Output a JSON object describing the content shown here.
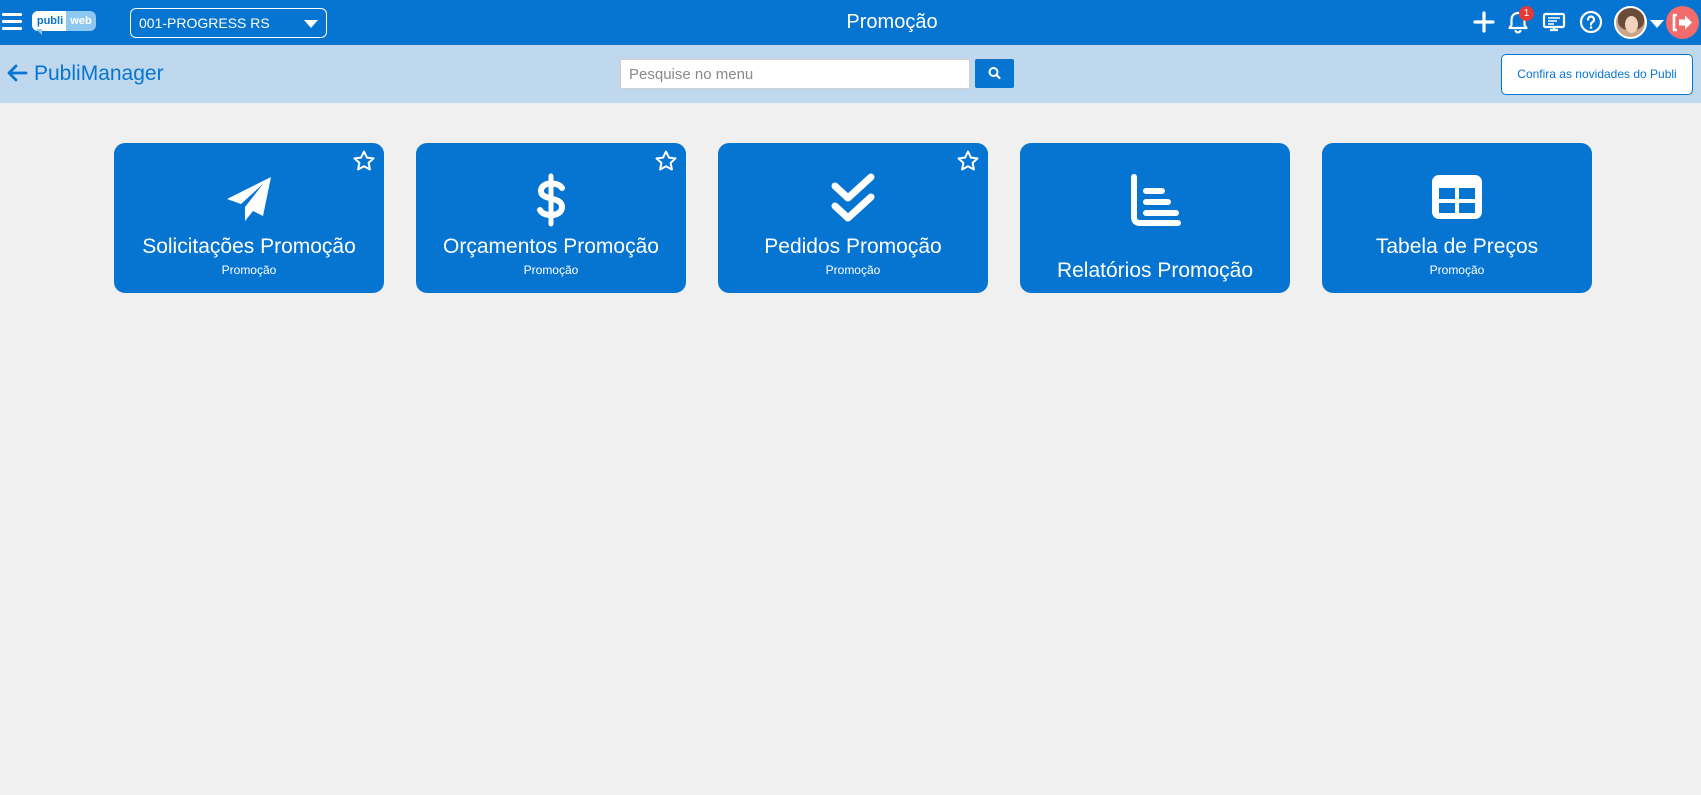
{
  "header": {
    "logo_publi": "publi",
    "logo_web": "web",
    "company": "001-PROGRESS RS",
    "title": "Promoção",
    "notifications_count": "1"
  },
  "subbar": {
    "back_label": "PubliManager",
    "search_placeholder": "Pesquise no menu",
    "news_button": "Confira as novidades do Publi"
  },
  "cards": [
    {
      "title": "Solicitações Promoção",
      "subtitle": "Promoção",
      "icon": "paper-plane-icon",
      "favorite": true
    },
    {
      "title": "Orçamentos Promoção",
      "subtitle": "Promoção",
      "icon": "dollar-icon",
      "favorite": true
    },
    {
      "title": "Pedidos Promoção",
      "subtitle": "Promoção",
      "icon": "double-check-icon",
      "favorite": true
    },
    {
      "title": "Relatórios Promoção",
      "subtitle": "",
      "icon": "bar-chart-icon",
      "favorite": false
    },
    {
      "title": "Tabela de Preços",
      "subtitle": "Promoção",
      "icon": "table-icon",
      "favorite": false
    }
  ],
  "colors": {
    "primary": "#0675d1",
    "subbar": "#c0d8ee",
    "background": "#f0f0f0",
    "badge": "#e53935",
    "logout": "#f36b6b"
  }
}
